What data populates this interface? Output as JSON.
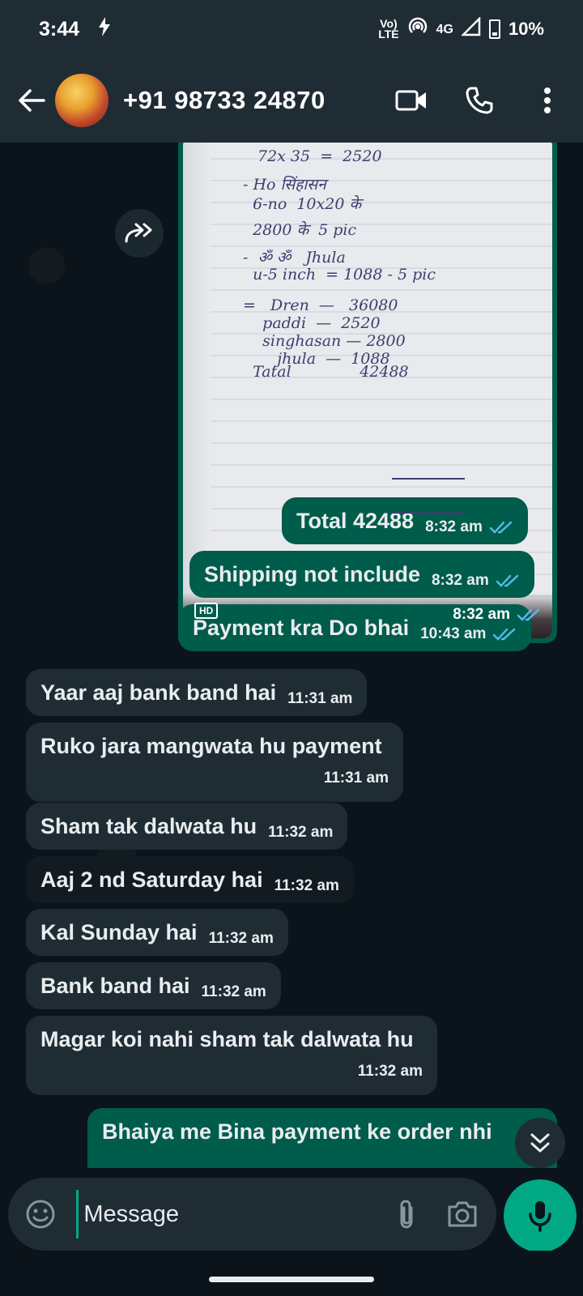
{
  "status_bar": {
    "time": "3:44",
    "volte": "Vo)",
    "lte": "LTE",
    "network": "4G",
    "battery": "10%"
  },
  "header": {
    "contact": "+91 98733 24870"
  },
  "image_message": {
    "badge": "HD",
    "time": "8:32 am",
    "note_lines": [
      "72x 35  =  2520",
      "- Ho सिंहासन",
      "  6-no  10x20 के",
      "  2800 के  5 pic",
      "-  ॐ ॐ   Jhula",
      "  u-5 inch  = 1088 - 5 pic",
      "=   Dren  —   36080",
      "    paddi  —  2520",
      "    singhasan — 2800",
      "       jhula  —  1088",
      "  Tatal              42488"
    ]
  },
  "messages": [
    {
      "dir": "out",
      "text": "Total 42488",
      "time": "8:32 am"
    },
    {
      "dir": "out",
      "text": "Shipping not include",
      "time": "8:32 am"
    },
    {
      "dir": "out",
      "text": "Payment kra Do bhai",
      "time": "10:43 am"
    },
    {
      "dir": "in",
      "text": "Yaar aaj bank band hai",
      "time": "11:31 am"
    },
    {
      "dir": "in",
      "text": "Ruko jara mangwata hu payment",
      "time": "11:31 am"
    },
    {
      "dir": "in",
      "text": "Sham tak dalwata hu",
      "time": "11:32 am"
    },
    {
      "dir": "in",
      "text": "Aaj 2 nd Saturday hai",
      "time": "11:32 am"
    },
    {
      "dir": "in",
      "text": "Kal Sunday hai",
      "time": "11:32 am"
    },
    {
      "dir": "in",
      "text": "Bank band hai",
      "time": "11:32 am"
    },
    {
      "dir": "in",
      "text": "Magar koi nahi sham tak dalwata hu",
      "time": "11:32 am"
    },
    {
      "dir": "out",
      "text": "Bhaiya me Bina payment ke order nhi",
      "time": ""
    }
  ],
  "input": {
    "placeholder": "Message"
  },
  "colors": {
    "outgoing": "#005c4b",
    "incoming": "#1f2c34",
    "accent": "#00a884",
    "read_ticks": "#53bdeb"
  },
  "icons": [
    "back-arrow-icon",
    "video-call-icon",
    "phone-icon",
    "more-vert-icon",
    "forward-icon",
    "double-check-icon",
    "chevron-down-icon",
    "emoji-icon",
    "attach-icon",
    "camera-icon",
    "mic-icon"
  ]
}
